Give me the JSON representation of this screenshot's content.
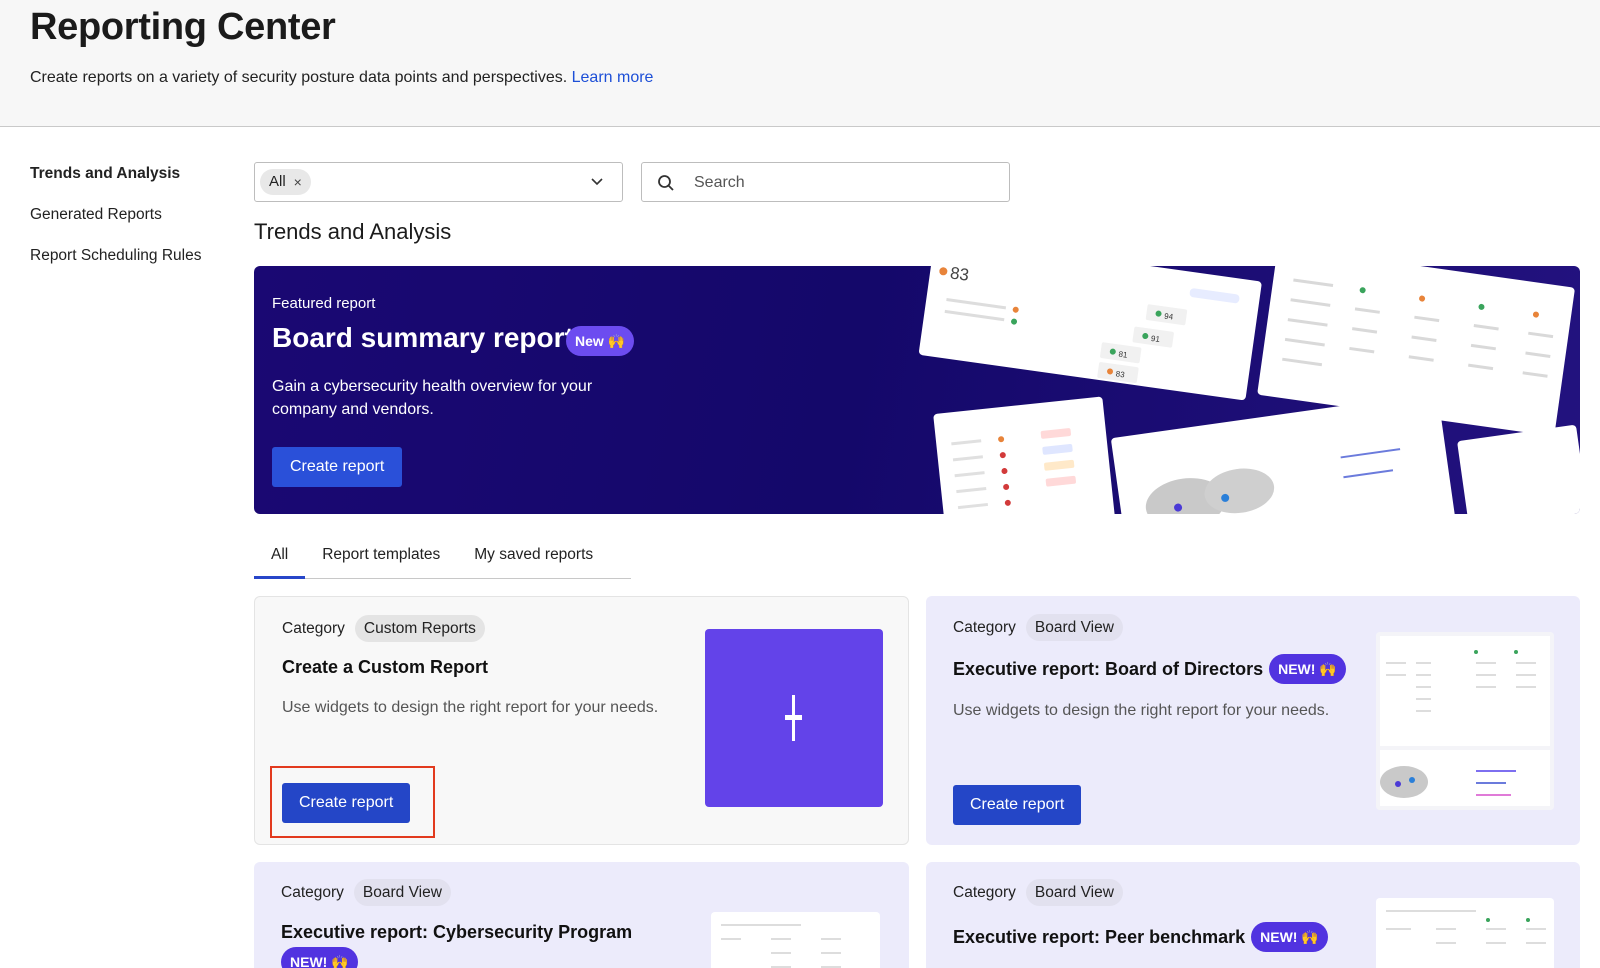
{
  "header": {
    "title": "Reporting Center",
    "subtitle": "Create reports on a variety of security posture data points and perspectives.",
    "learn_more": "Learn more"
  },
  "sidebar": {
    "items": [
      {
        "label": "Trends and Analysis",
        "active": true
      },
      {
        "label": "Generated Reports",
        "active": false
      },
      {
        "label": "Report Scheduling Rules",
        "active": false
      }
    ]
  },
  "filter": {
    "chip": "All",
    "chip_remove": "×"
  },
  "search": {
    "placeholder": "Search"
  },
  "section": {
    "title": "Trends and Analysis"
  },
  "featured": {
    "kicker": "Featured report",
    "title": "Board summary report",
    "badge": "New 🙌",
    "description": "Gain a cybersecurity health overview for your company and vendors.",
    "button": "Create report",
    "preview": {
      "score_a": "83",
      "score_b": "94",
      "score_c": "91",
      "score_d": "81",
      "score_e": "83"
    }
  },
  "tabs": [
    {
      "label": "All",
      "active": true
    },
    {
      "label": "Report templates",
      "active": false
    },
    {
      "label": "My saved reports",
      "active": false
    }
  ],
  "cards": [
    {
      "category_label": "Category",
      "category": "Custom Reports",
      "title": "Create a Custom Report",
      "badge": "",
      "description": "Use widgets to design the right report for your needs.",
      "button": "Create report"
    },
    {
      "category_label": "Category",
      "category": "Board View",
      "title": "Executive report: Board of Directors",
      "badge": "NEW! 🙌",
      "description": "Use widgets to design the right report for your needs.",
      "button": "Create report"
    },
    {
      "category_label": "Category",
      "category": "Board View",
      "title": "Executive report: Cybersecurity Program",
      "badge": "NEW! 🙌"
    },
    {
      "category_label": "Category",
      "category": "Board View",
      "title": "Executive report: Peer benchmark",
      "badge": "NEW! 🙌"
    }
  ],
  "colors": {
    "accent": "#2446c7",
    "badge": "#5133e0",
    "hero_bg": "#14086a",
    "highlight": "#e23a1e"
  }
}
